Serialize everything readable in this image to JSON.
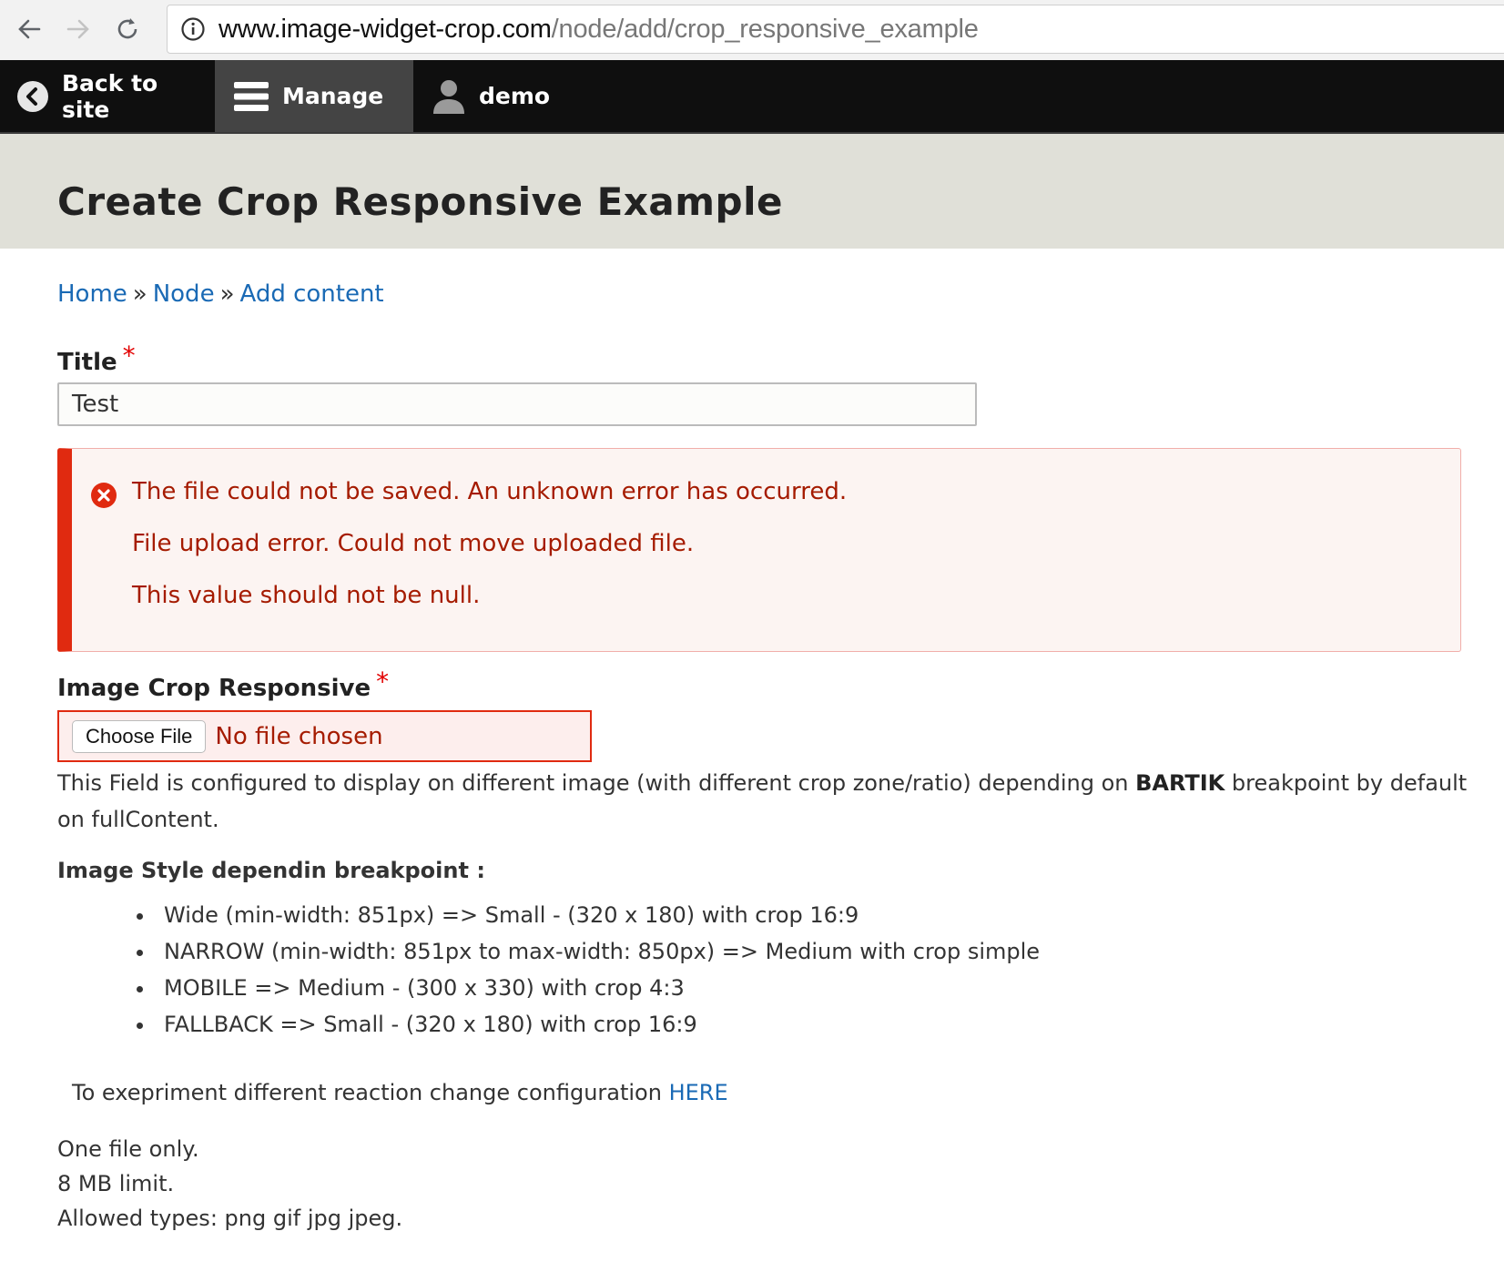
{
  "browser": {
    "url_host": "www.image-widget-crop.com",
    "url_path": "/node/add/crop_responsive_example"
  },
  "toolbar": {
    "back_label": "Back to site",
    "manage_label": "Manage",
    "user_label": "demo"
  },
  "page": {
    "title": "Create Crop Responsive Example"
  },
  "breadcrumb": {
    "items": [
      "Home",
      "Node",
      "Add content"
    ],
    "separator": "»"
  },
  "form": {
    "title_label": "Title",
    "required_mark": "*",
    "title_value": "Test",
    "image_label": "Image Crop Responsive",
    "choose_file_label": "Choose File",
    "no_file_text": "No file chosen"
  },
  "errors": [
    "The file could not be saved. An unknown error has occurred.",
    "File upload error. Could not move uploaded file.",
    "This value should not be null."
  ],
  "description": {
    "intro_before": "This Field is configured to display on different image (with different crop zone/ratio) depending on ",
    "intro_bold": "BARTIK",
    "intro_after": " breakpoint by default on fullContent.",
    "style_heading": "Image Style dependin breakpoint :",
    "breakpoints": [
      "Wide (min-width: 851px) => Small - (320 x 180) with crop 16:9",
      "NARROW (min-width: 851px to max-width: 850px) => Medium with crop simple",
      "MOBILE => Medium - (300 x 330) with crop 4:3",
      "FALLBACK => Small - (320 x 180) with crop 16:9"
    ],
    "experiment_text": "To exepriment different reaction change configuration ",
    "experiment_link": "HERE"
  },
  "help": {
    "one_file": "One file only.",
    "limit": "8 MB limit.",
    "types": "Allowed types: png gif jpg jpeg."
  },
  "colors": {
    "link": "#1a6ab5",
    "error_text": "#a51b00",
    "error_border": "#e02a10",
    "required": "#e20000",
    "toolbar_bg": "#0f0f0f",
    "header_bg": "#e0e0d8"
  }
}
